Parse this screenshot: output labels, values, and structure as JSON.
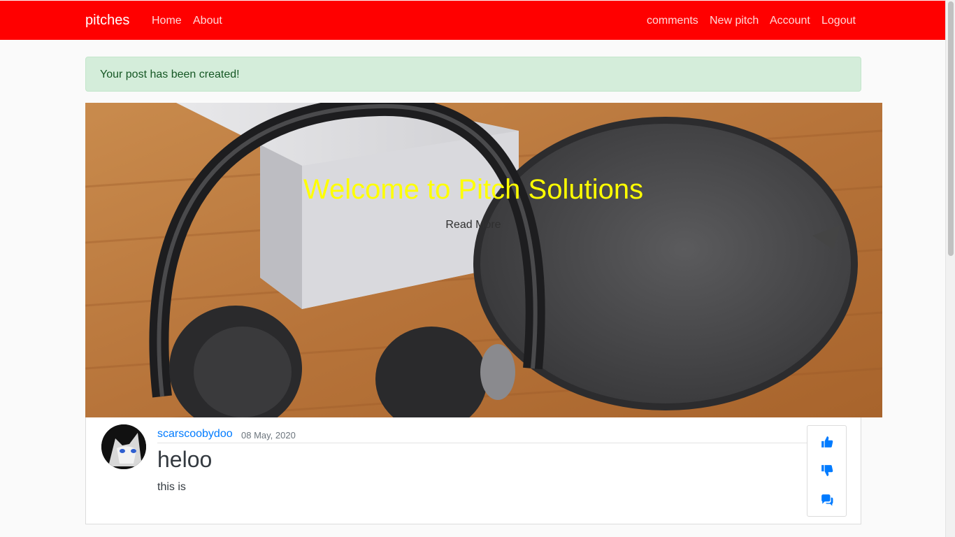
{
  "navbar": {
    "brand": "pitches",
    "links_left": [
      "Home",
      "About"
    ],
    "links_right": [
      "comments",
      "New pitch",
      "Account",
      "Logout"
    ],
    "background": "#ff0000"
  },
  "alert": {
    "message": "Your post has been created!",
    "color": "#d4edda"
  },
  "hero": {
    "title": "Welcome to Pitch Solutions",
    "link": "Read More",
    "title_color": "#ffff00"
  },
  "post": {
    "author": "scarscoobydoo",
    "date": "08 May, 2020",
    "title": "heloo",
    "body": "this is",
    "actions": [
      "thumbs-up-icon",
      "thumbs-down-icon",
      "comments-icon"
    ],
    "action_color": "#007bff"
  }
}
